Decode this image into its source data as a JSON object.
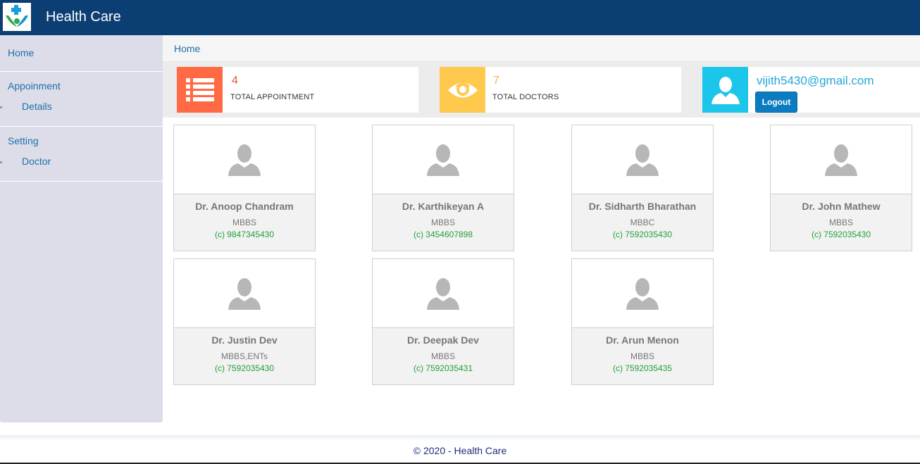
{
  "header": {
    "title": "Health Care",
    "logo_icon": "hands-cross-icon"
  },
  "sidebar": {
    "home": "Home",
    "appointment": "Appoinment",
    "details": "Details",
    "setting": "Setting",
    "doctor": "Doctor"
  },
  "breadcrumb": {
    "home": "Home"
  },
  "stats": {
    "appointments": {
      "value": "4",
      "label": "TOTAL APPOINTMENT",
      "icon": "list-icon",
      "color": "#ff6a45",
      "value_color": "#e8553a"
    },
    "doctors": {
      "value": "7",
      "label": "TOTAL DOCTORS",
      "icon": "eye-icon",
      "color": "#ffc94d",
      "value_color": "#f3b344"
    },
    "user": {
      "email": "vijith5430@gmail.com",
      "logout_label": "Logout",
      "icon": "user-icon",
      "color": "#1cc6ea"
    }
  },
  "doctors": [
    {
      "name": "Dr. Anoop Chandram",
      "degree": "MBBS",
      "phone": "(c) 9847345430"
    },
    {
      "name": "Dr. Karthikeyan A",
      "degree": "MBBS",
      "phone": "(c) 3454607898"
    },
    {
      "name": "Dr. Sidharth Bharathan",
      "degree": "MBBC",
      "phone": "(c) 7592035430"
    },
    {
      "name": "Dr. John Mathew",
      "degree": "MBBS",
      "phone": "(c) 7592035430"
    },
    {
      "name": "Dr. Justin Dev",
      "degree": "MBBS,ENTs",
      "phone": "(c) 7592035430"
    },
    {
      "name": "Dr. Deepak Dev",
      "degree": "MBBS",
      "phone": "(c) 7592035431"
    },
    {
      "name": "Dr. Arun Menon",
      "degree": "MBBS",
      "phone": "(c) 7592035435"
    }
  ],
  "footer": {
    "text": "© 2020 - Health Care"
  }
}
